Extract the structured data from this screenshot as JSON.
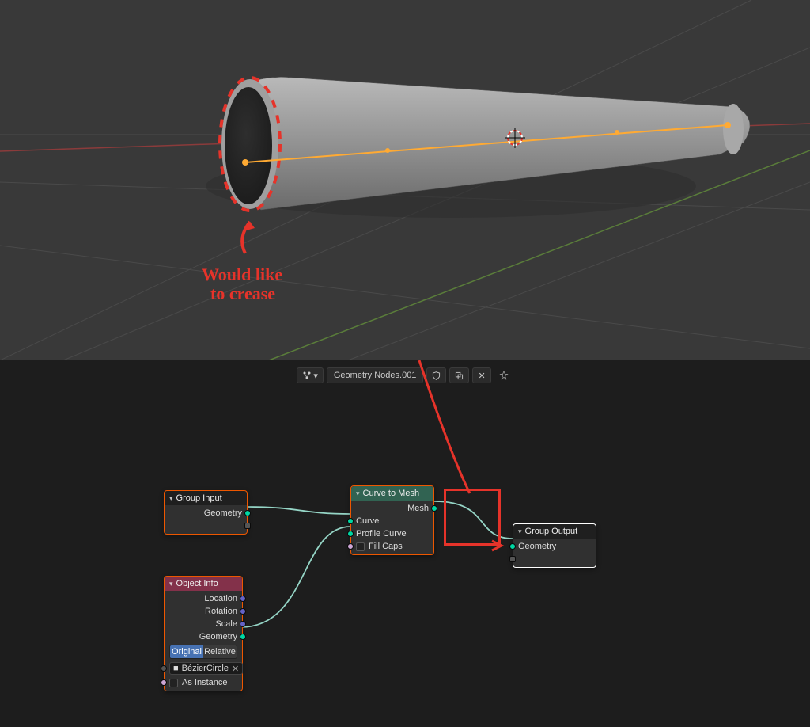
{
  "viewport": {
    "annotation_line1": "Would like",
    "annotation_line2": "to crease"
  },
  "header": {
    "nodegroup_name": "Geometry Nodes.001"
  },
  "nodes": {
    "group_input": {
      "title": "Group Input",
      "out_geometry": "Geometry"
    },
    "curve_to_mesh": {
      "title": "Curve to Mesh",
      "out_mesh": "Mesh",
      "in_curve": "Curve",
      "in_profile": "Profile Curve",
      "in_fillcaps": "Fill Caps"
    },
    "group_output": {
      "title": "Group Output",
      "in_geometry": "Geometry"
    },
    "object_info": {
      "title": "Object Info",
      "out_location": "Location",
      "out_rotation": "Rotation",
      "out_scale": "Scale",
      "out_geometry": "Geometry",
      "mode_original": "Original",
      "mode_relative": "Relative",
      "object_name": "BézierCircle",
      "as_instance": "As Instance"
    }
  }
}
